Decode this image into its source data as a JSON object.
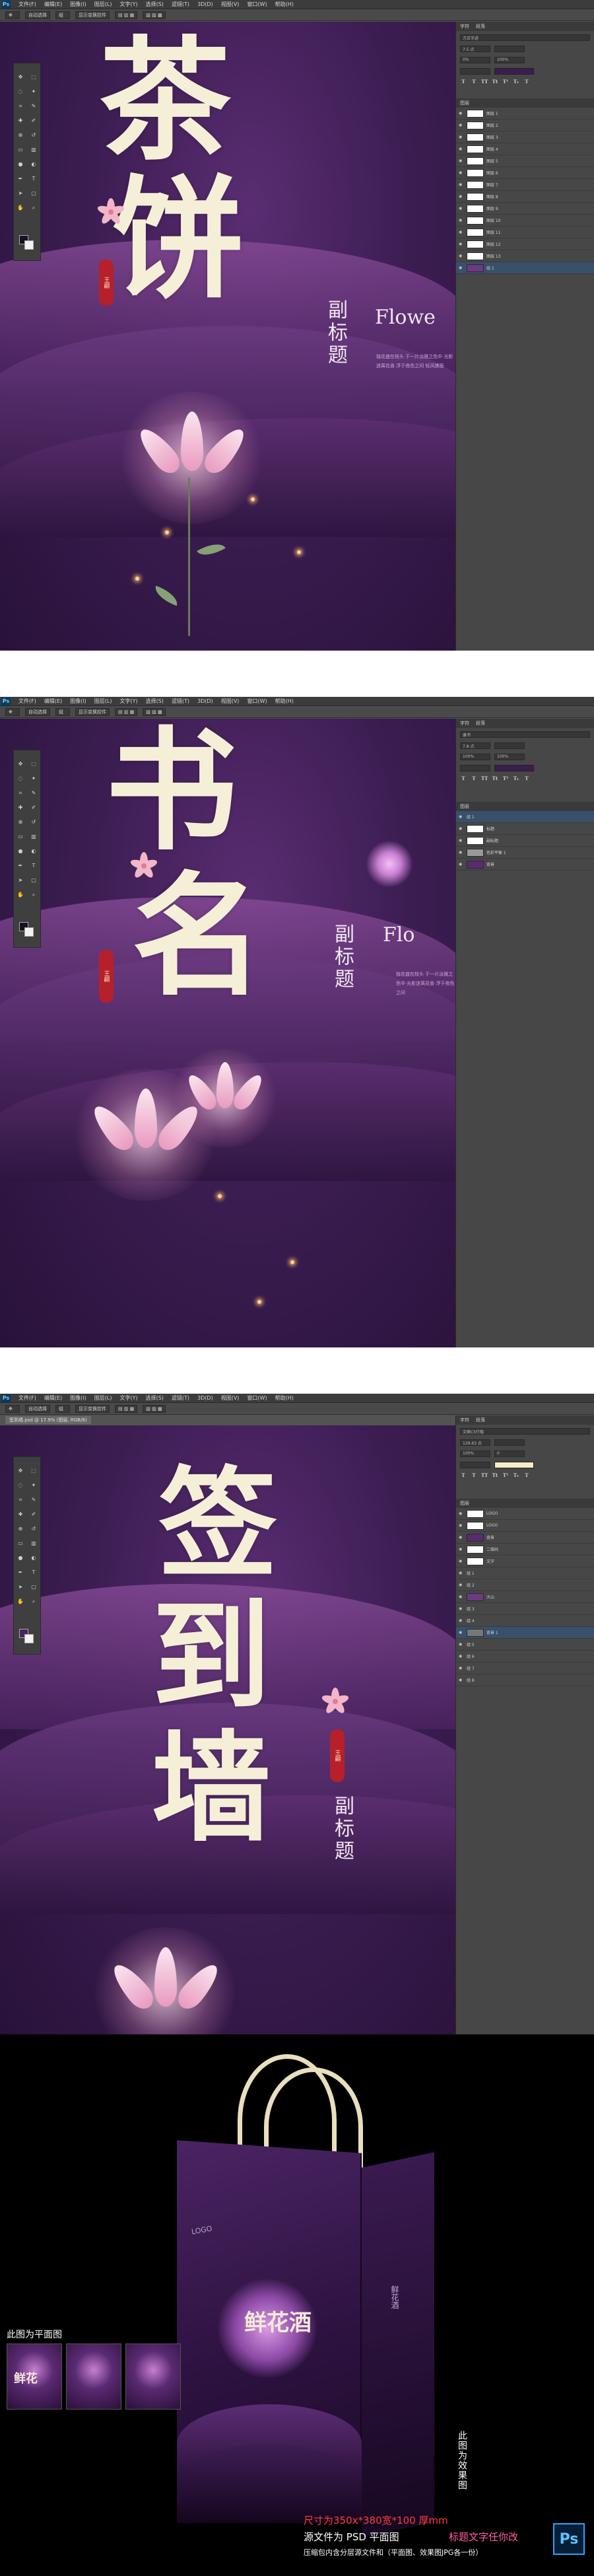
{
  "menu": [
    "文件(F)",
    "编辑(E)",
    "图像(I)",
    "图层(L)",
    "文字(Y)",
    "选择(S)",
    "滤镜(T)",
    "3D(D)",
    "视图(V)",
    "窗口(W)",
    "帮助(H)"
  ],
  "options": [
    "自动选择",
    "组",
    "显示变换控件"
  ],
  "screens": [
    {
      "title_chars": [
        "茶",
        "饼"
      ],
      "seal": "王顧",
      "subtitle": "副标题",
      "flower_text": "Flowe",
      "tiny_text": "独花盛在枝头 于一片淡雅之色中 光影迷离花香 浮于夜色之间 轻风拂面",
      "doc_tab": "",
      "panel_tabs": [
        "字符",
        "段落"
      ],
      "font_field": "方正字迹",
      "size_field": "7.5 点",
      "pct1": "0%",
      "pct2": "100%",
      "layer_head": "图层",
      "layers": [
        "图层 1",
        "图层 2",
        "图层 3",
        "图层 4",
        "图层 5",
        "图层 6",
        "图层 7",
        "图层 8",
        "图层 9",
        "图层 10",
        "图层 11",
        "图层 12",
        "图层 13",
        "组 1"
      ]
    },
    {
      "title_chars": [
        "书",
        "名"
      ],
      "seal": "王顧",
      "subtitle": "副标题",
      "flower_text": "Flo",
      "tiny_text": "独花盛在枝头 于一片淡雅之色中 光影迷离花香 浮于夜色之间",
      "doc_tab": "",
      "panel_tabs": [
        "字符",
        "段落"
      ],
      "font_field": "隶书",
      "size_field": "7.8 点",
      "pct1": "100%",
      "pct2": "100%",
      "layer_head": "图层",
      "layers": [
        "组 1",
        "标题",
        "副标题",
        "色彩平衡 1",
        "背景"
      ]
    },
    {
      "title_chars": [
        "签",
        "到",
        "墙"
      ],
      "seal": "王顧",
      "subtitle": "副标题",
      "flower_text": "",
      "tiny_text": "",
      "doc_tab": "签到墙.psd @ 17.9% (图层, RGB/8)",
      "panel_tabs": [
        "字符",
        "段落"
      ],
      "font_field": "文鼎CS行楷",
      "size_field": "129.63 点",
      "pct1": "100%",
      "pct2": "0",
      "layer_head": "图层",
      "layers": [
        "LOGO",
        "LOGO",
        "背景",
        "二维码",
        "文字",
        "组 1",
        "组 2",
        "大山",
        "组 3",
        "组 4",
        "背景 1",
        "组 5",
        "组 6",
        "组 7",
        "组 8"
      ]
    }
  ],
  "bag": {
    "logo": "LOGO",
    "title": "鲜花酒",
    "side_text": "鲜花酒",
    "right_label": "此图为效果图",
    "flat_label": "此图为平面图",
    "thumb_text": "鲜花"
  },
  "info": {
    "size_line": "尺寸为350x*380宽*100 厚mm",
    "source_line": "源文件为 PSD 平面图",
    "change_line": "标题文字任你改",
    "pack_line": "压缩包内含分层源文件和（平面图、效果图JPG各一份）",
    "ps_badge": "Ps"
  },
  "colors": {
    "canvas": "#3b1e4e",
    "title": "#f5efd8",
    "seal": "#b5202a",
    "petal": "#f2b6c8",
    "accent_red": "#ff3b3b"
  }
}
